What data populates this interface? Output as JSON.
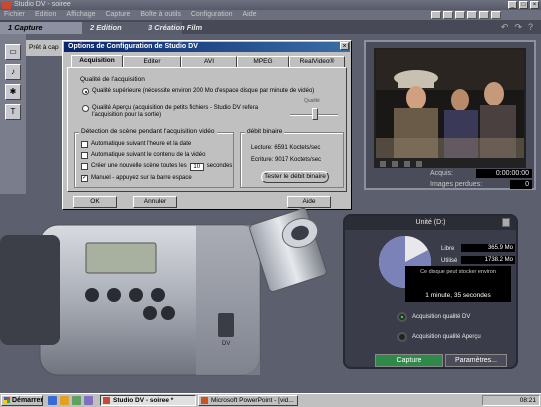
{
  "window": {
    "title": "Studio DV - soiree"
  },
  "menubar": [
    "Fichier",
    "Edition",
    "Affichage",
    "Capture",
    "Boîte à outils",
    "Configuration",
    "Aide"
  ],
  "studio_tabs": [
    "1 Capture",
    "2 Edition",
    "3 Création Film"
  ],
  "status_strip": "Prêt à cap",
  "dialog": {
    "title": "Options de Configuration de Studio DV",
    "close": "×",
    "tabs": [
      "Acquisition",
      "Editer",
      "AVI",
      "MPEG",
      "RealVideo®"
    ],
    "quality_group": "Qualité de l'acquisition",
    "quality_high": "Qualité supérieure (nécessite environ 200 Mo d'espace disque par minute de vidéo)",
    "quality_preview": "Qualité Aperçu (acquisition de petits fichiers - Studio DV refera l'acquisition pour la sortie)",
    "slider_label": "Qualité",
    "scene_group": "Détection de scène pendant l'acquisition vidéo",
    "scene_opt1": "Automatique suivant l'heure et la date",
    "scene_opt2": "Automatique suivant le contenu de la vidéo",
    "scene_opt3_prefix": "Créer une nouvelle scène toutes les",
    "scene_opt3_value": "10",
    "scene_opt3_suffix": "secondes",
    "scene_opt4": "Manuel - appuyez sur la barre espace",
    "throughput_group": "débit binaire",
    "read_rate": "Lecture: 6591 Koctets/sec",
    "write_rate": "Ecriture: 9017 Koctets/sec",
    "test_button": "Tester le débit binaire",
    "ok": "OK",
    "cancel": "Annuler",
    "help": "Aide"
  },
  "monitor": {
    "acquis_label": "Acquis:",
    "acquis_value": "0:00:00:00",
    "dropped_label": "Images perdues:",
    "dropped_value": "0"
  },
  "camera": {
    "label": "DV"
  },
  "disk": {
    "title": "Unité (D:)",
    "free_label": "Libre",
    "free_value": "365.9 Mo",
    "used_label": "Utilisé",
    "used_value": "1738.2 Mo",
    "free_fraction": 0.174,
    "capacity_text": "Ce disque peut stocker environ",
    "capacity_time": "1 minute, 35 secondes",
    "opt_dv": "Acquisition qualité DV",
    "opt_preview": "Acquisition qualité Aperçu",
    "capture_button": "Capture",
    "params_button": "Paramètres..."
  },
  "taskbar": {
    "start": "Démarrer",
    "buttons": [
      "Studio DV - soiree *",
      "Microsoft PowerPoint - [vid..."
    ],
    "clock": "08:21"
  },
  "colors": {
    "titlebar_blue": "#0a246a",
    "panel_green": "#2f8a4a",
    "disk_used": "#7a82b8"
  }
}
